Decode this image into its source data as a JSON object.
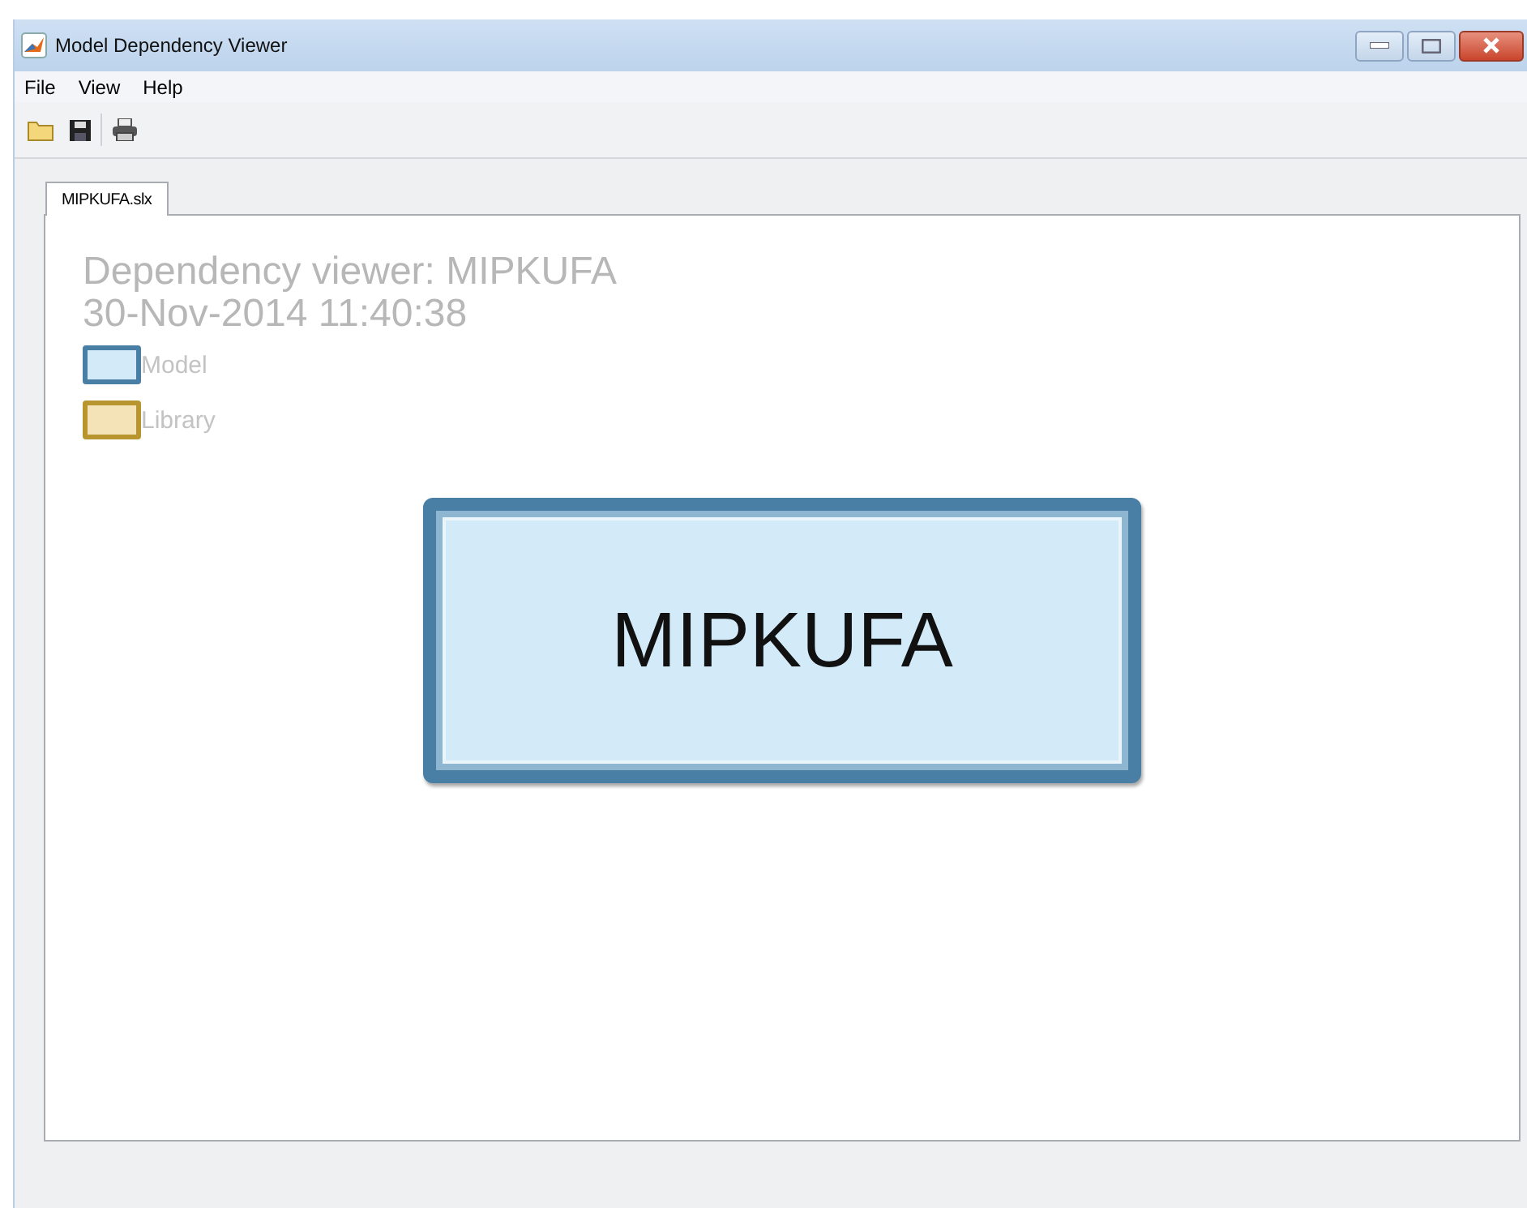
{
  "window": {
    "title": "Model Dependency Viewer"
  },
  "menu": [
    "File",
    "View",
    "Help"
  ],
  "toolbar": [
    {
      "kind": "open"
    },
    {
      "kind": "save"
    },
    {
      "kind": "print"
    }
  ],
  "tabs": [
    {
      "label": "MIPKUFA.slx",
      "selected": true
    }
  ],
  "diagram": {
    "title": "Dependency viewer: MIPKUFA",
    "timestamp": "30-Nov-2014 11:40:38",
    "legend": [
      {
        "label": "Model",
        "color": "#d3ebf9"
      },
      {
        "label": "Library",
        "color": "#f5e3b8"
      }
    ],
    "nodes": [
      {
        "label": "MIPKUFA",
        "kind": "model"
      }
    ]
  }
}
